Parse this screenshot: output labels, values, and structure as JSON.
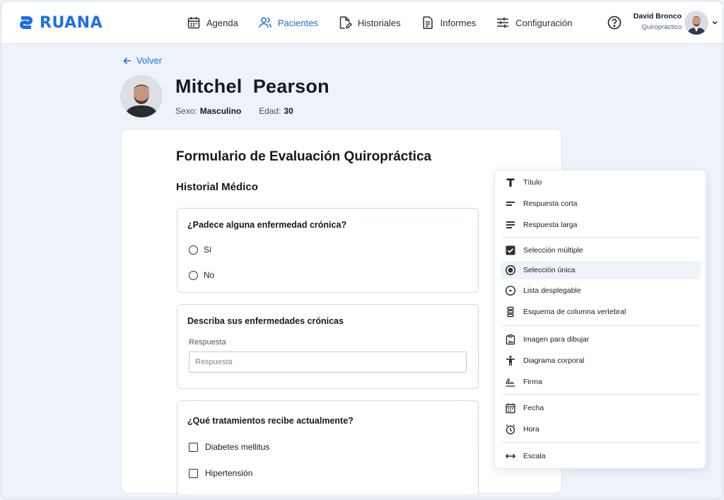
{
  "brand": {
    "name": "RUANA",
    "color": "#1c6fe6"
  },
  "nav": {
    "items": [
      {
        "label": "Agenda",
        "icon": "calendar-icon",
        "active": false
      },
      {
        "label": "Pacientes",
        "icon": "users-icon",
        "active": true
      },
      {
        "label": "Historiales",
        "icon": "file-edit-icon",
        "active": false
      },
      {
        "label": "Informes",
        "icon": "document-icon",
        "active": false
      },
      {
        "label": "Configuración",
        "icon": "sliders-icon",
        "active": false
      }
    ]
  },
  "user": {
    "name": "David Bronco",
    "role": "Quiropráctico"
  },
  "back_label": "Volver",
  "patient": {
    "name": "Mitchel  Pearson",
    "sex_label": "Sexo:",
    "sex": "Masculino",
    "age_label": "Edad:",
    "age": "30"
  },
  "form": {
    "title": "Formulario de Evaluación Quiropráctica",
    "section": "Historial Médico",
    "q1": {
      "title": "¿Padece alguna enfermedad crónica?",
      "options": [
        "Sí",
        "No"
      ]
    },
    "q2": {
      "title": "Describa sus enfermedades crónicas",
      "label": "Respuesta",
      "placeholder": "Respuesta"
    },
    "q3": {
      "title": "¿Qué tratamientos recibe actualmente?",
      "options": [
        "Diabetes mellitus",
        "Hipertensión"
      ]
    }
  },
  "menu": {
    "items": [
      {
        "label": "Título",
        "icon": "title-icon"
      },
      {
        "label": "Respuesta corta",
        "icon": "short-answer-icon"
      },
      {
        "label": "Respuesta larga",
        "icon": "long-answer-icon"
      },
      {
        "label": "Selección múltiple",
        "icon": "checkbox-checked-icon"
      },
      {
        "label": "Selección única",
        "icon": "radio-selected-icon",
        "highlighted": true
      },
      {
        "label": "Lista desplegable",
        "icon": "dropdown-circle-icon"
      },
      {
        "label": "Esquema de columna vertebral",
        "icon": "spine-icon"
      },
      {
        "label": "Imagen para dibujar",
        "icon": "draw-image-icon"
      },
      {
        "label": "Diagrama corporal",
        "icon": "body-diagram-icon"
      },
      {
        "label": "Firma",
        "icon": "signature-icon"
      },
      {
        "label": "Fecha",
        "icon": "date-icon"
      },
      {
        "label": "Hora",
        "icon": "clock-icon"
      },
      {
        "label": "Escala",
        "icon": "scale-arrows-icon"
      }
    ]
  }
}
